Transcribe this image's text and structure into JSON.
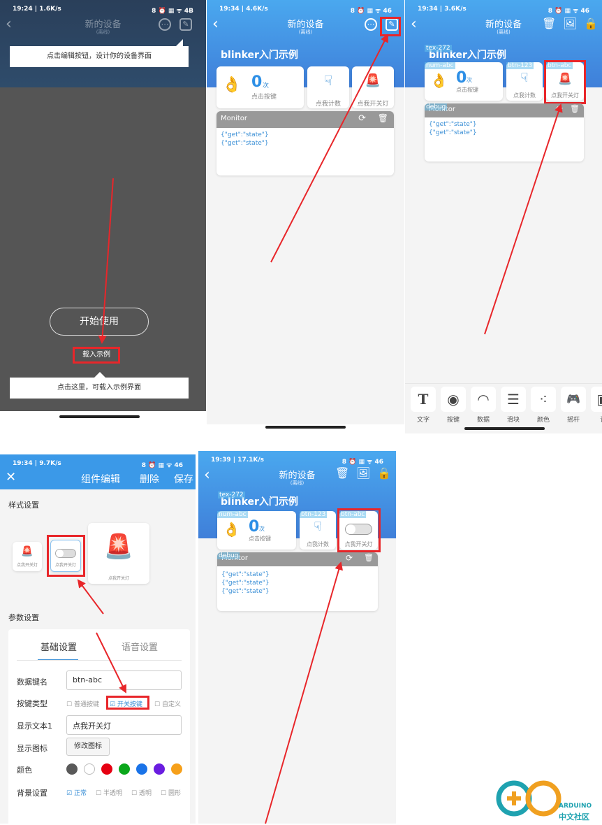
{
  "panel1": {
    "status_time": "19:24 | 1.6K/s",
    "status_icons": "8 ⏰ ▦ ᯤ 4B",
    "title": "新的设备",
    "subtitle": "(离线)",
    "tip_edit": "点击编辑按钮，设计你的设备界面",
    "start_button": "开始使用",
    "load_example": "载入示例",
    "tip_load": "点击这里，可载入示例界面"
  },
  "panel2": {
    "status_time": "19:34 | 4.6K/s",
    "status_icons": "8 ⏰ ▦ ᯤ 46",
    "title": "新的设备",
    "subtitle": "(离线)",
    "heading": "blinker入门示例",
    "count_value": "0",
    "count_unit": "次",
    "count_label": "点击按键",
    "btn1_label": "点我计数",
    "btn2_label": "点我开关灯",
    "monitor_title": "Monitor",
    "monitor_lines": [
      "{\"get\":\"state\"}",
      "{\"get\":\"state\"}"
    ]
  },
  "panel3": {
    "status_time": "19:34 | 3.6K/s",
    "status_icons": "8 ⏰ ▦ ᯤ 46",
    "title": "新的设备",
    "subtitle": "(离线)",
    "heading": "blinker入门示例",
    "tag_text": "tex-272",
    "tag_num": "num-abc",
    "tag_btn1": "btn-123",
    "tag_btn2": "btn-abc",
    "tag_debug": "debug",
    "count_value": "0",
    "count_unit": "次",
    "count_label": "点击按键",
    "btn1_label": "点我计数",
    "btn2_label": "点我开关灯",
    "monitor_title": "Monitor",
    "monitor_lines": [
      "{\"get\":\"state\"}",
      "{\"get\":\"state\"}"
    ],
    "tools": [
      {
        "icon": "T",
        "label": "文字"
      },
      {
        "icon": "◉",
        "label": "按键"
      },
      {
        "icon": "◠",
        "label": "数据"
      },
      {
        "icon": "☰",
        "label": "滑块"
      },
      {
        "icon": "⁖",
        "label": "颜色"
      },
      {
        "icon": "🎮",
        "label": "摇杆"
      },
      {
        "icon": "▣",
        "label": "调"
      }
    ]
  },
  "panel4": {
    "status_time": "19:34 | 9.7K/s",
    "status_icons": "8 ⏰ ▦ ᯤ 46",
    "title": "组件编辑",
    "delete": "删除",
    "save": "保存",
    "style_section": "样式设置",
    "preview_label": "点我开关灯",
    "param_section": "参数设置",
    "tab_basic": "基础设置",
    "tab_voice": "语音设置",
    "key_label": "数据键名",
    "key_value": "btn-abc",
    "type_label": "按键类型",
    "type_options": [
      "普通按键",
      "开关按键",
      "自定义"
    ],
    "type_selected": "开关按键",
    "text_label": "显示文本1",
    "text_value": "点我开关灯",
    "icon_label": "显示图标",
    "icon_button": "修改图标",
    "color_label": "颜色",
    "colors": [
      "#595959",
      "#ffffff",
      "#e60012",
      "#0aa71b",
      "#1a73e8",
      "#6a1de0",
      "#f6a01a"
    ],
    "bg_label": "背景设置",
    "bg_options": [
      "正常",
      "半透明",
      "透明",
      "圆形"
    ],
    "bg_selected": "正常"
  },
  "panel5": {
    "status_time": "19:39 | 17.1K/s",
    "status_icons": "8 ⏰ ▦ ᯤ 46",
    "title": "新的设备",
    "subtitle": "(离线)",
    "heading": "blinker入门示例",
    "tag_text": "tex-272",
    "tag_num": "num-abc",
    "tag_btn1": "btn-123",
    "tag_btn2": "btn-abc",
    "tag_debug": "debug",
    "count_value": "0",
    "count_unit": "次",
    "count_label": "点击按键",
    "btn1_label": "点我计数",
    "btn2_label": "点我开关灯",
    "monitor_title": "Monitor",
    "monitor_lines": [
      "{\"get\":\"state\"}",
      "{\"get\":\"state\"}",
      "{\"get\":\"state\"}"
    ],
    "toggle_on": false
  },
  "logo": {
    "text_en": "ARDUINO",
    "text_cn": "中文社区"
  },
  "colors": {
    "accent": "#3a8fd6",
    "highlight": "#e8262a",
    "header": "#3b99e8",
    "overlay": "#555555"
  }
}
